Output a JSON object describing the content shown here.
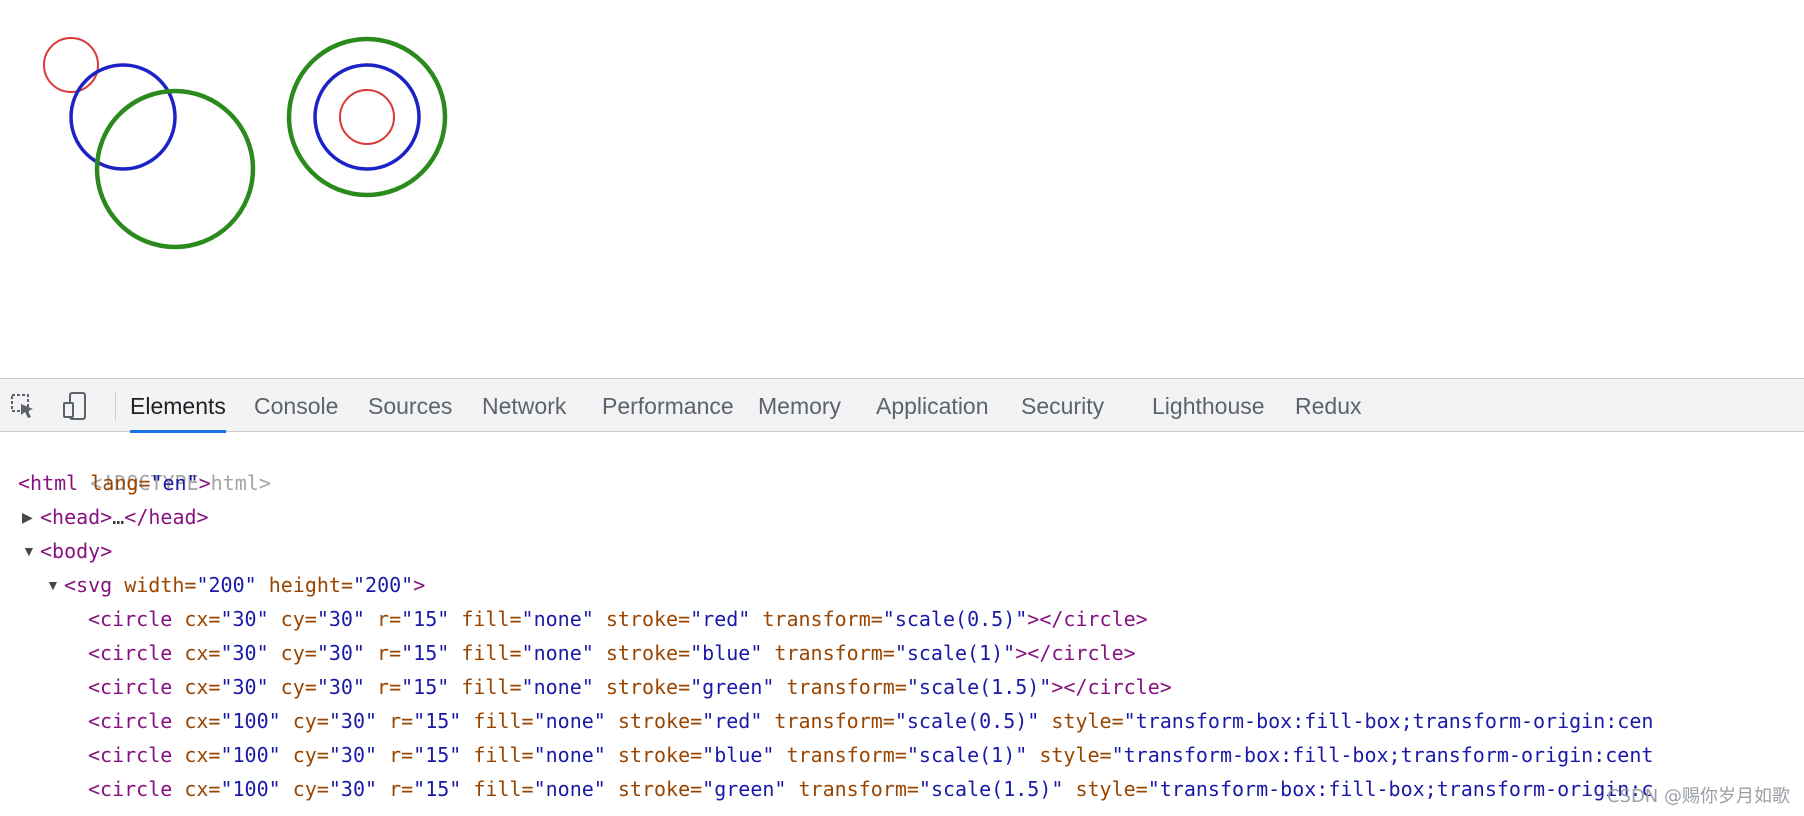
{
  "colors": {
    "red": "#d93a36",
    "blue": "#1b22c6",
    "green": "#2a8a1c",
    "tab_accent": "#1a73e8"
  },
  "icons": {
    "inspect": "cursor-select-icon",
    "device": "device-toggle-icon"
  },
  "tabs": [
    {
      "label": "Elements",
      "active": true
    },
    {
      "label": "Console"
    },
    {
      "label": "Sources"
    },
    {
      "label": "Network"
    },
    {
      "label": "Performance"
    },
    {
      "label": "Memory"
    },
    {
      "label": "Application"
    },
    {
      "label": "Security"
    },
    {
      "label": "Lighthouse"
    },
    {
      "label": "Redux"
    }
  ],
  "tree": {
    "doctype": "<!DOCTYPE html>",
    "html_open": {
      "tag": "<html",
      "attr": " lang=",
      "val": "\"en\"",
      "end": ">"
    },
    "head": {
      "open": "<head>",
      "dots": "…",
      "close": "</head>"
    },
    "body": "<body>",
    "svg": {
      "tag": "<svg",
      "a1": " width=",
      "v1": "\"200\"",
      "a2": " height=",
      "v2": "\"200\"",
      "end": ">"
    },
    "circles": [
      {
        "cx": "\"30\"",
        "cy": "\"30\"",
        "r": "\"15\"",
        "fill": "\"none\"",
        "stroke": "\"red\"",
        "transform": "\"scale(0.5)\"",
        "style": "",
        "close": "></circle>"
      },
      {
        "cx": "\"30\"",
        "cy": "\"30\"",
        "r": "\"15\"",
        "fill": "\"none\"",
        "stroke": "\"blue\"",
        "transform": "\"scale(1)\"",
        "style": "",
        "close": "></circle>"
      },
      {
        "cx": "\"30\"",
        "cy": "\"30\"",
        "r": "\"15\"",
        "fill": "\"none\"",
        "stroke": "\"green\"",
        "transform": "\"scale(1.5)\"",
        "style": "",
        "close": "></circle>"
      },
      {
        "cx": "\"100\"",
        "cy": "\"30\"",
        "r": "\"15\"",
        "fill": "\"none\"",
        "stroke": "\"red\"",
        "transform": "\"scale(0.5)\"",
        "style": "\"transform-box:fill-box;transform-origin:cen",
        "close": ""
      },
      {
        "cx": "\"100\"",
        "cy": "\"30\"",
        "r": "\"15\"",
        "fill": "\"none\"",
        "stroke": "\"blue\"",
        "transform": "\"scale(1)\"",
        "style": "\"transform-box:fill-box;transform-origin:cent",
        "close": ""
      },
      {
        "cx": "\"100\"",
        "cy": "\"30\"",
        "r": "\"15\"",
        "fill": "\"none\"",
        "stroke": "\"green\"",
        "transform": "\"scale(1.5)\"",
        "style": "\"transform-box:fill-box;transform-origin:c",
        "close": ""
      }
    ]
  },
  "watermark": "CSDN @赐你岁月如歌"
}
